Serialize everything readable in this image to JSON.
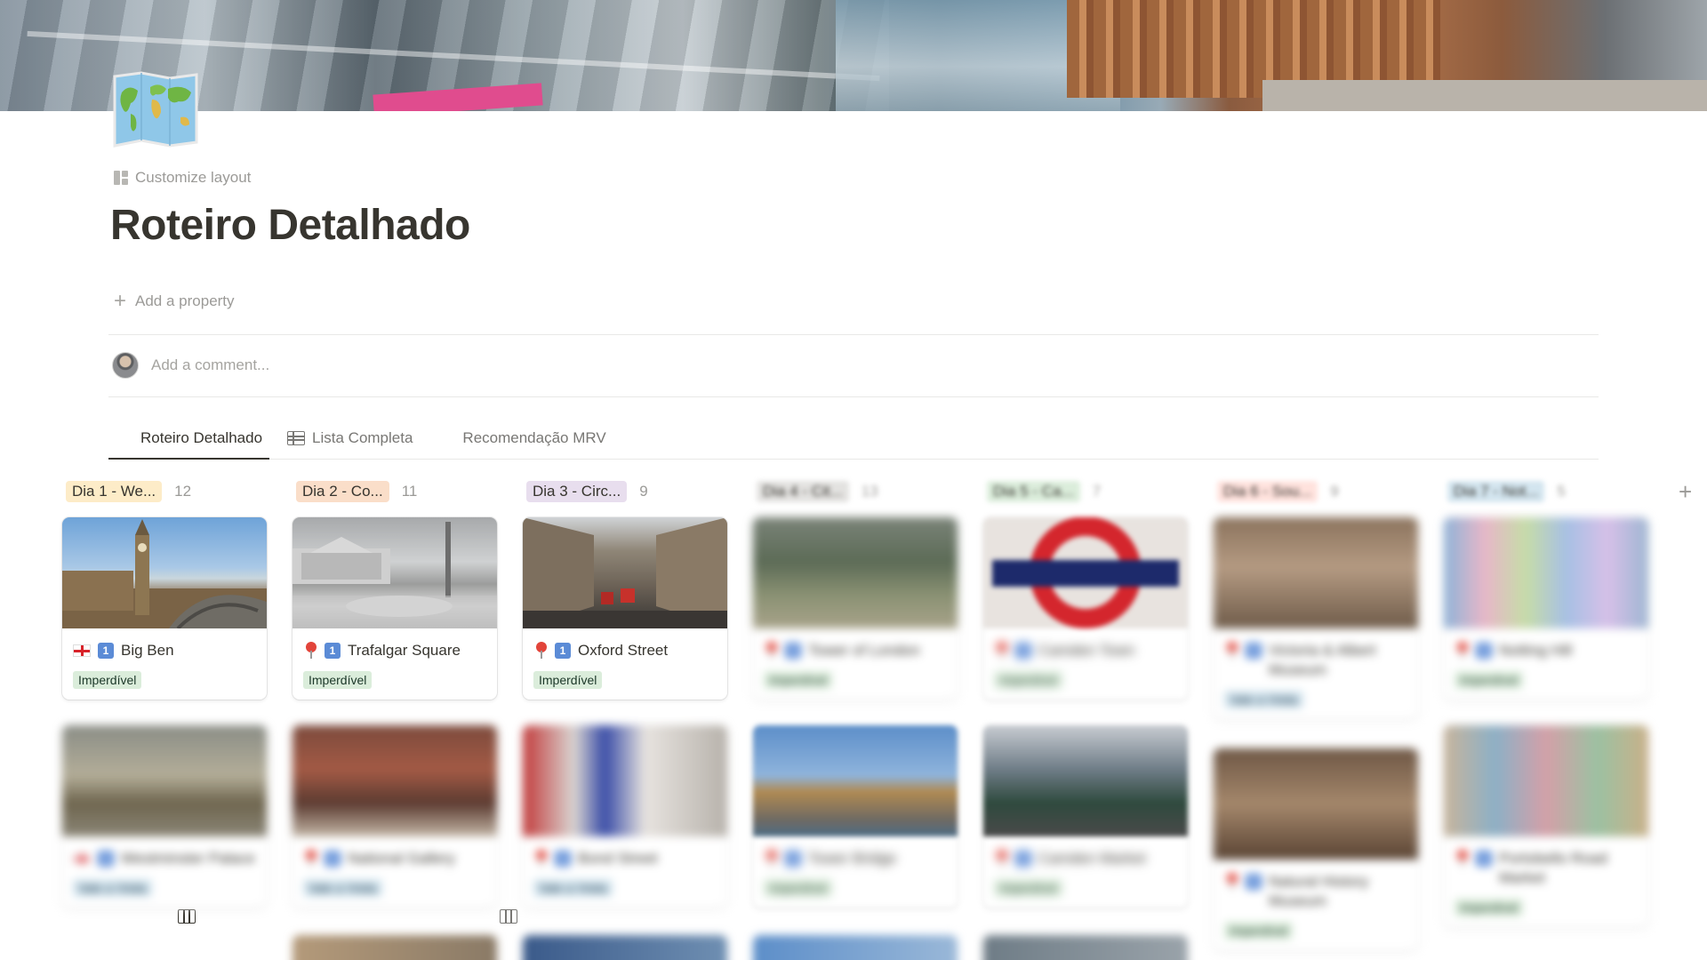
{
  "page": {
    "customize_label": "Customize layout",
    "title": "Roteiro Detalhado",
    "add_property_label": "Add a property",
    "comment_placeholder": "Add a comment..."
  },
  "tabs": [
    {
      "label": "Roteiro Detalhado",
      "icon": "board-icon",
      "active": true
    },
    {
      "label": "Lista Completa",
      "icon": "table-icon",
      "active": false
    },
    {
      "label": "Recomendação MRV",
      "icon": "board-icon",
      "active": false
    }
  ],
  "colors": {
    "group_yellow": "#fdecc8",
    "group_orange": "#fadec9",
    "group_purple": "#e8deee",
    "group_gray": "#e3e2e0",
    "group_green": "#dbeddb",
    "group_red": "#ffe2dd",
    "group_blue": "#d3e5ef",
    "badge_green": "#dbeddb"
  },
  "columns": [
    {
      "label": "Dia 1 - We...",
      "count": "12",
      "cards": [
        {
          "name": "Big Ben",
          "number_icon": "1",
          "emoji": "england-flag-icon",
          "badge": "Imperdível"
        },
        {
          "name": "Westminster Palace",
          "number_icon": "1",
          "emoji": "england-flag-icon",
          "badge": "Vale a Visita"
        }
      ]
    },
    {
      "label": "Dia 2 - Co...",
      "count": "11",
      "cards": [
        {
          "name": "Trafalgar Square",
          "number_icon": "1",
          "emoji": "pin-icon",
          "badge": "Imperdível"
        },
        {
          "name": "National Gallery",
          "number_icon": "1",
          "emoji": "pin-icon",
          "badge": "Vale a Visita"
        }
      ]
    },
    {
      "label": "Dia 3 - Circ...",
      "count": "9",
      "cards": [
        {
          "name": "Oxford Street",
          "number_icon": "1",
          "emoji": "pin-icon",
          "badge": "Imperdível"
        },
        {
          "name": "Bond Street",
          "number_icon": "1",
          "emoji": "pin-icon",
          "badge": "Vale a Visita"
        }
      ]
    },
    {
      "label": "Dia 4 - Cit...",
      "count": "13",
      "cards": [
        {
          "name": "Tower of London",
          "number_icon": "1",
          "emoji": "pin-icon",
          "badge": "Imperdível"
        },
        {
          "name": "Tower Bridge",
          "number_icon": "1",
          "emoji": "pin-icon",
          "badge": "Imperdível"
        }
      ]
    },
    {
      "label": "Dia 5 - Ca...",
      "count": "7",
      "cards": [
        {
          "name": "Camden Town",
          "number_icon": "1",
          "emoji": "pin-icon",
          "badge": "Imperdível"
        },
        {
          "name": "Camden Market",
          "number_icon": "1",
          "emoji": "pin-icon",
          "badge": "Imperdível"
        }
      ]
    },
    {
      "label": "Dia 6 - Sou...",
      "count": "9",
      "cards": [
        {
          "name": "Victoria & Albert Museum",
          "number_icon": "1",
          "emoji": "pin-icon",
          "badge": "Vale a Visita"
        },
        {
          "name": "Natural History Museum",
          "number_icon": "1",
          "emoji": "pin-icon",
          "badge": "Imperdível"
        }
      ]
    },
    {
      "label": "Dia 7 - Not...",
      "count": "5",
      "cards": [
        {
          "name": "Notting Hill",
          "number_icon": "1",
          "emoji": "pin-icon",
          "badge": "Imperdível"
        },
        {
          "name": "Portobello Road Market",
          "number_icon": "1",
          "emoji": "pin-icon",
          "badge": "Imperdível"
        }
      ]
    }
  ]
}
